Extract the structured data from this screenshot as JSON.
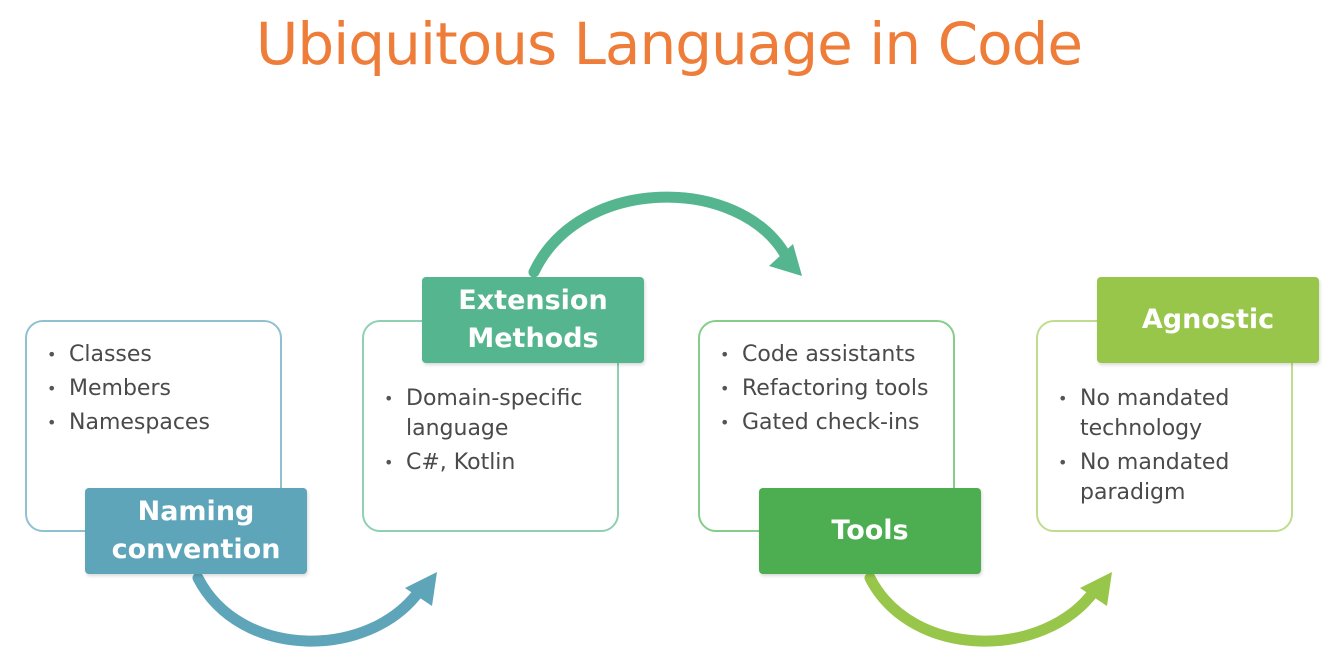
{
  "title": "Ubiquitous Language in Code",
  "colors": {
    "title": "#ef7d3a",
    "naming": "#5ea5ba",
    "extension": "#54b58e",
    "tools": "#4cae50",
    "agnostic": "#98c64a"
  },
  "steps": [
    {
      "label": "Naming convention",
      "bullets": [
        "Classes",
        "Members",
        "Namespaces"
      ]
    },
    {
      "label": "Extension Methods",
      "bullets": [
        "Domain-specific language",
        "C#, Kotlin"
      ]
    },
    {
      "label": "Tools",
      "bullets": [
        "Code assistants",
        "Refactoring tools",
        "Gated check-ins"
      ]
    },
    {
      "label": "Agnostic",
      "bullets": [
        "No mandated technology",
        "No mandated paradigm"
      ]
    }
  ]
}
